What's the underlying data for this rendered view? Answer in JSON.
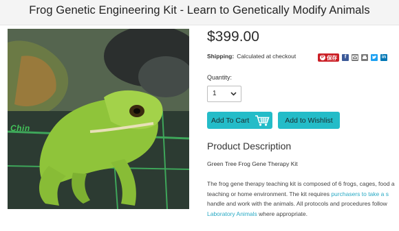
{
  "header": {
    "title": "Frog Genetic Engineering Kit - Learn to Genetically Modify Animals"
  },
  "product": {
    "image_text": "Chin",
    "price": "$399.00",
    "shipping_label": "Shipping:",
    "shipping_value": "Calculated at checkout",
    "quantity_label": "Quantity:",
    "quantity_value": "1",
    "add_to_cart": "Add To Cart",
    "add_to_wishlist": "Add to Wishlist"
  },
  "share": {
    "pinterest_label": "保存",
    "icons": [
      "facebook-icon",
      "email-icon",
      "print-icon",
      "twitter-icon",
      "linkedin-icon"
    ],
    "colors": {
      "facebook": "#3b5998",
      "email": "#7a7a7a",
      "print": "#7a7a7a",
      "twitter": "#1da1f2",
      "linkedin": "#0077b5",
      "pinterest": "#cb2027"
    }
  },
  "description": {
    "heading": "Product Description",
    "subtitle": "Green Tree Frog Gene Therapy Kit",
    "line1": "The frog gene therapy teaching kit is composed of 6 frogs, cages, food a",
    "line2_text": "teaching or home environment. The kit requires ",
    "line2_link": "purchasers to take a s",
    "line3": "handle and work with the animals. All protocols and procedures follow",
    "line4_link": "Laboratory Animals",
    "line4_text": " where appropriate."
  },
  "colors": {
    "accent": "#24bcc8",
    "link": "#27a9c4",
    "header_bg": "#f4f4f4"
  }
}
